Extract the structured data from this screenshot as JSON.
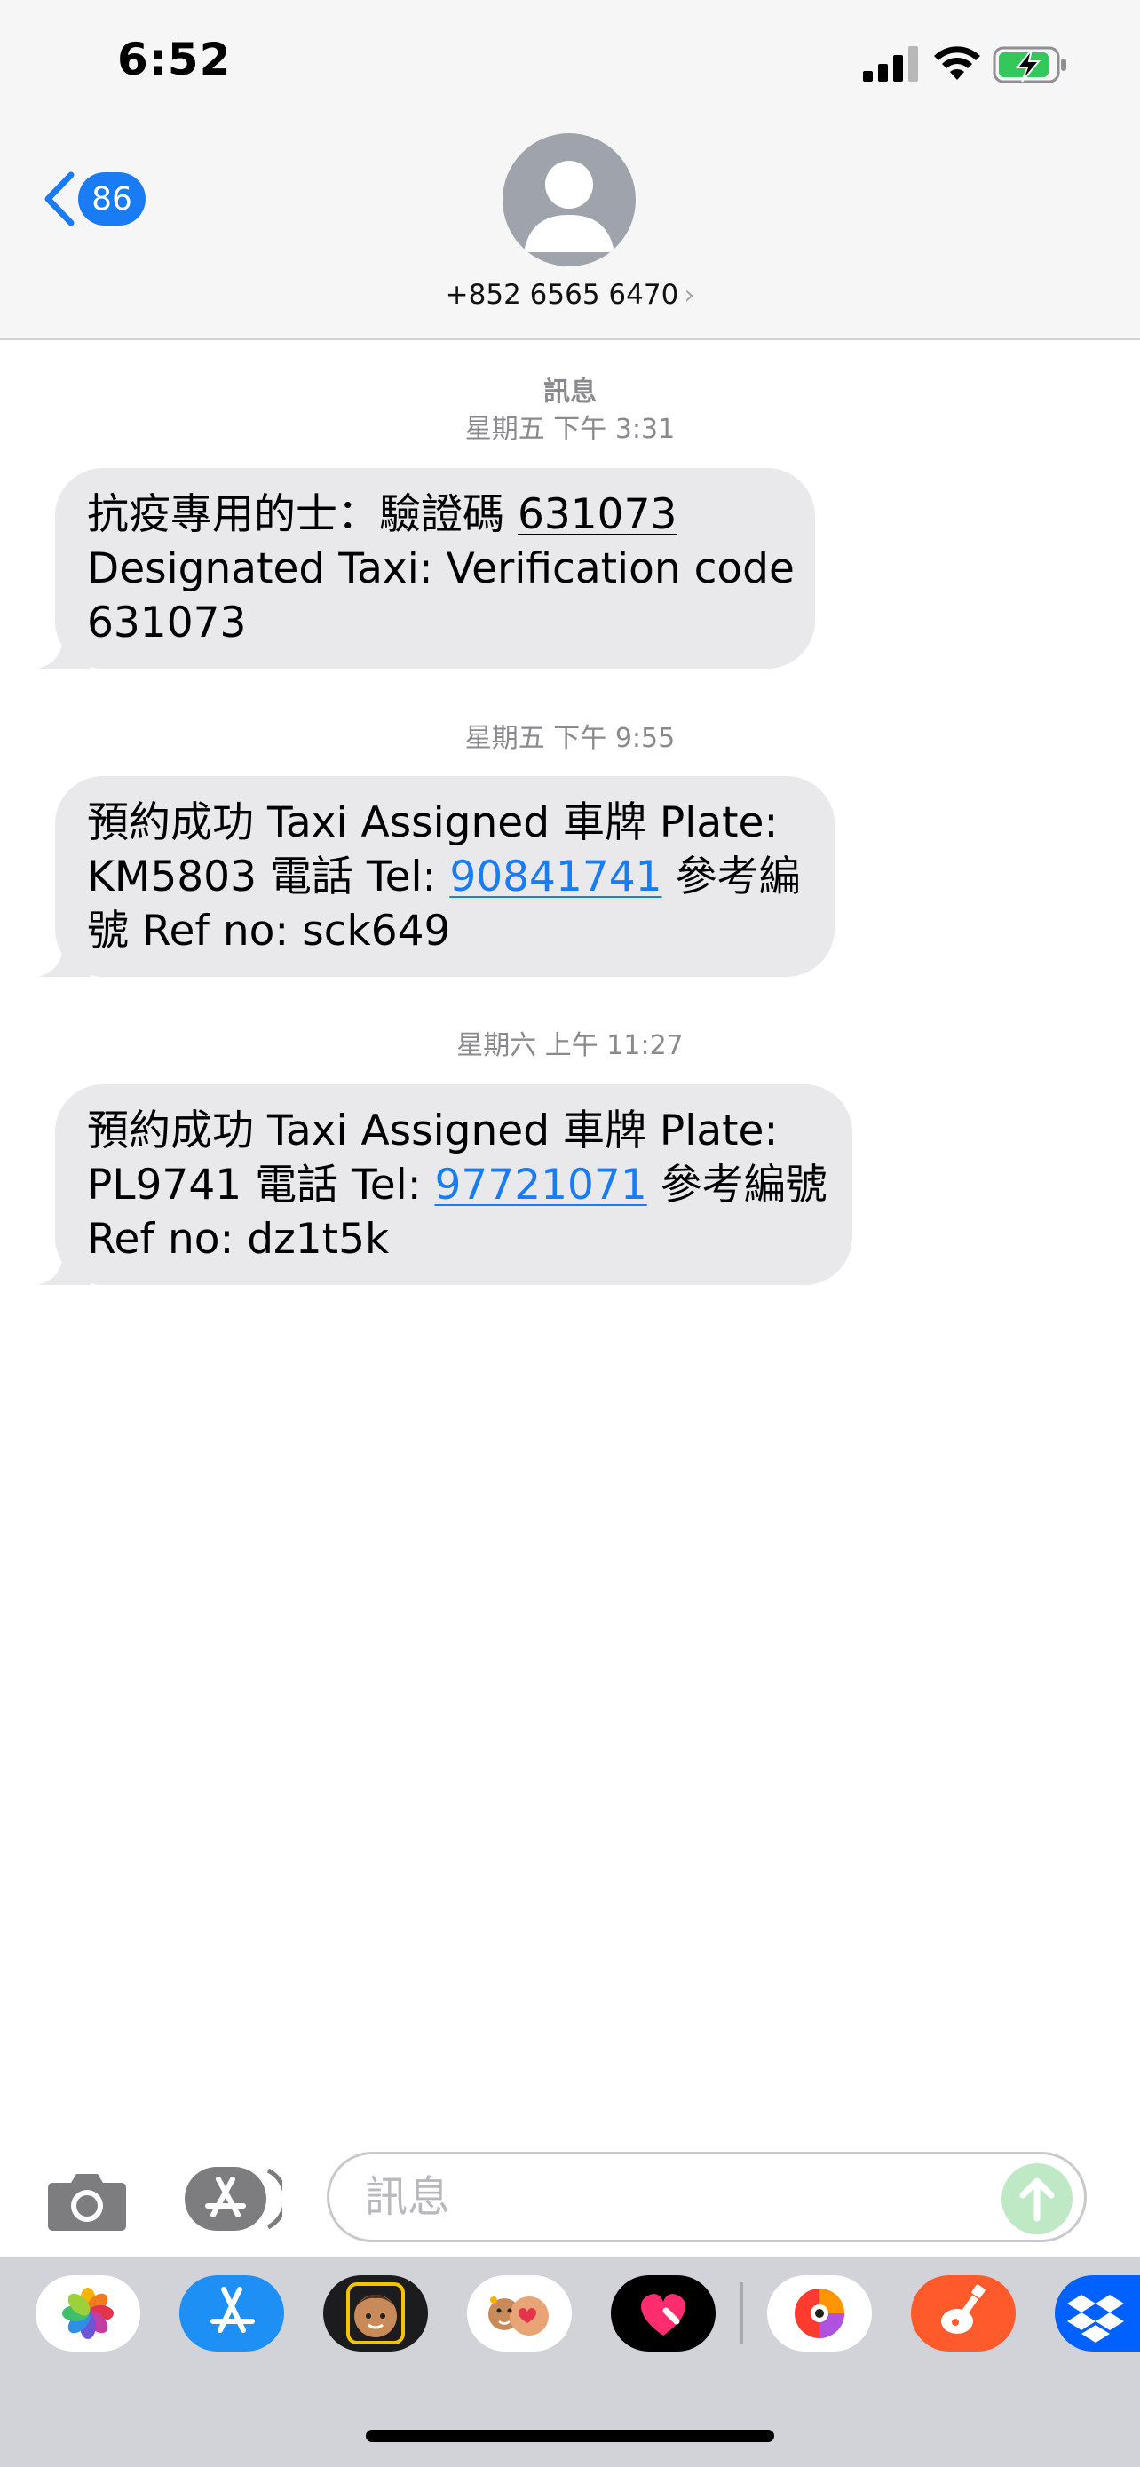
{
  "status_bar": {
    "time": "6:52"
  },
  "header": {
    "back_badge": "86",
    "contact": "+852 6565 6470",
    "contact_chevron": "›"
  },
  "conversation": {
    "service_label": "訊息",
    "messages": [
      {
        "timestamp": "星期五 下午 3:31",
        "line1_prefix": "抗疫專用的士：驗證碼 ",
        "line1_code": "631073",
        "line2": "Designated Taxi: Verification code",
        "line3": "631073"
      },
      {
        "timestamp": "星期五 下午 9:55",
        "line1": "預約成功 Taxi Assigned 車牌 Plate:",
        "line2_prefix": "KM5803 電話 Tel: ",
        "line2_phone": "90841741",
        "line2_suffix": " 參考編",
        "line3": "號 Ref no: sck649"
      },
      {
        "timestamp": "星期六 上午 11:27",
        "line1": "預約成功 Taxi Assigned 車牌 Plate:",
        "line2_prefix": "PL9741 電話 Tel: ",
        "line2_phone": "97721071",
        "line2_suffix": " 參考編號",
        "line3": "Ref no: dz1t5k"
      }
    ]
  },
  "input": {
    "placeholder": "訊息"
  },
  "app_drawer": {
    "apps": [
      "photos-icon",
      "app-store-icon",
      "memoji-stickers-icon",
      "memoji-icon",
      "digital-touch-icon",
      "colorful-app-icon",
      "garageband-icon",
      "dropbox-icon"
    ]
  },
  "colors": {
    "accent": "#1a7cf5",
    "bubble_gray": "#e9e9eb",
    "header_bg": "#f6f6f6",
    "send_disabled": "#bfe9c5"
  }
}
